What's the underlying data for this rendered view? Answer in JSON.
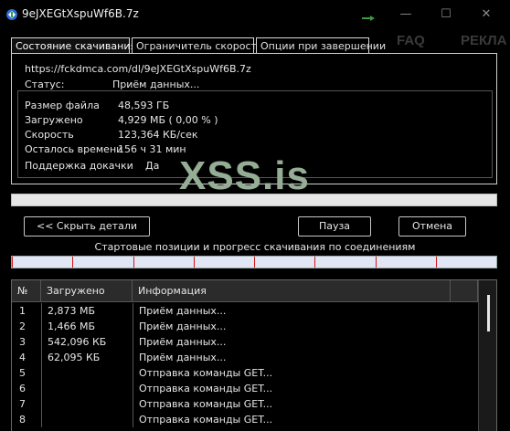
{
  "window": {
    "title": "9eJXEGtXspuWf6B.7z",
    "minimize": "—",
    "maximize": "☐",
    "close": "✕",
    "accent": "#4caf50"
  },
  "background_site": {
    "nav": [
      "FAQ",
      "РЕКЛА"
    ],
    "watermark": "XSS.is"
  },
  "tabs": [
    {
      "label": "Состояние скачивания",
      "active": true
    },
    {
      "label": "Ограничитель скорости",
      "active": false
    },
    {
      "label": "Опции при завершении",
      "active": false
    }
  ],
  "status_panel": {
    "url": "https://fckdmca.com/dl/9eJXEGtXspuWf6B.7z",
    "status_label": "Статус:",
    "status_value": "Приём данных...",
    "file_size_label": "Размер файла",
    "file_size_value": "48,593 ГБ",
    "downloaded_label": "Загружено",
    "downloaded_value": "4,929 МБ ( 0,00 % )",
    "speed_label": "Скорость",
    "speed_value": "123,364 КБ/сек",
    "time_left_label": "Осталось времени",
    "time_left_value": "156 ч 31 мин",
    "resume_label": "Поддержка докачки",
    "resume_value": "Да"
  },
  "progress": {
    "fraction": 0.0
  },
  "buttons": {
    "hide_details": "<< Скрыть детали",
    "pause": "Пауза",
    "cancel": "Отмена"
  },
  "connections_label": "Стартовые позиции и прогресс скачивания по соединениям",
  "connections_table": {
    "headers": [
      "№",
      "Загружено",
      "Информация"
    ],
    "rows": [
      {
        "no": "1",
        "downloaded": "2,873 МБ",
        "info": "Приём данных..."
      },
      {
        "no": "2",
        "downloaded": "1,466 МБ",
        "info": "Приём данных..."
      },
      {
        "no": "3",
        "downloaded": "542,096 КБ",
        "info": "Приём данных..."
      },
      {
        "no": "4",
        "downloaded": "62,095 КБ",
        "info": "Приём данных..."
      },
      {
        "no": "5",
        "downloaded": "",
        "info": "Отправка команды GET..."
      },
      {
        "no": "6",
        "downloaded": "",
        "info": "Отправка команды GET..."
      },
      {
        "no": "7",
        "downloaded": "",
        "info": "Отправка команды GET..."
      },
      {
        "no": "8",
        "downloaded": "",
        "info": "Отправка команды GET..."
      }
    ]
  }
}
